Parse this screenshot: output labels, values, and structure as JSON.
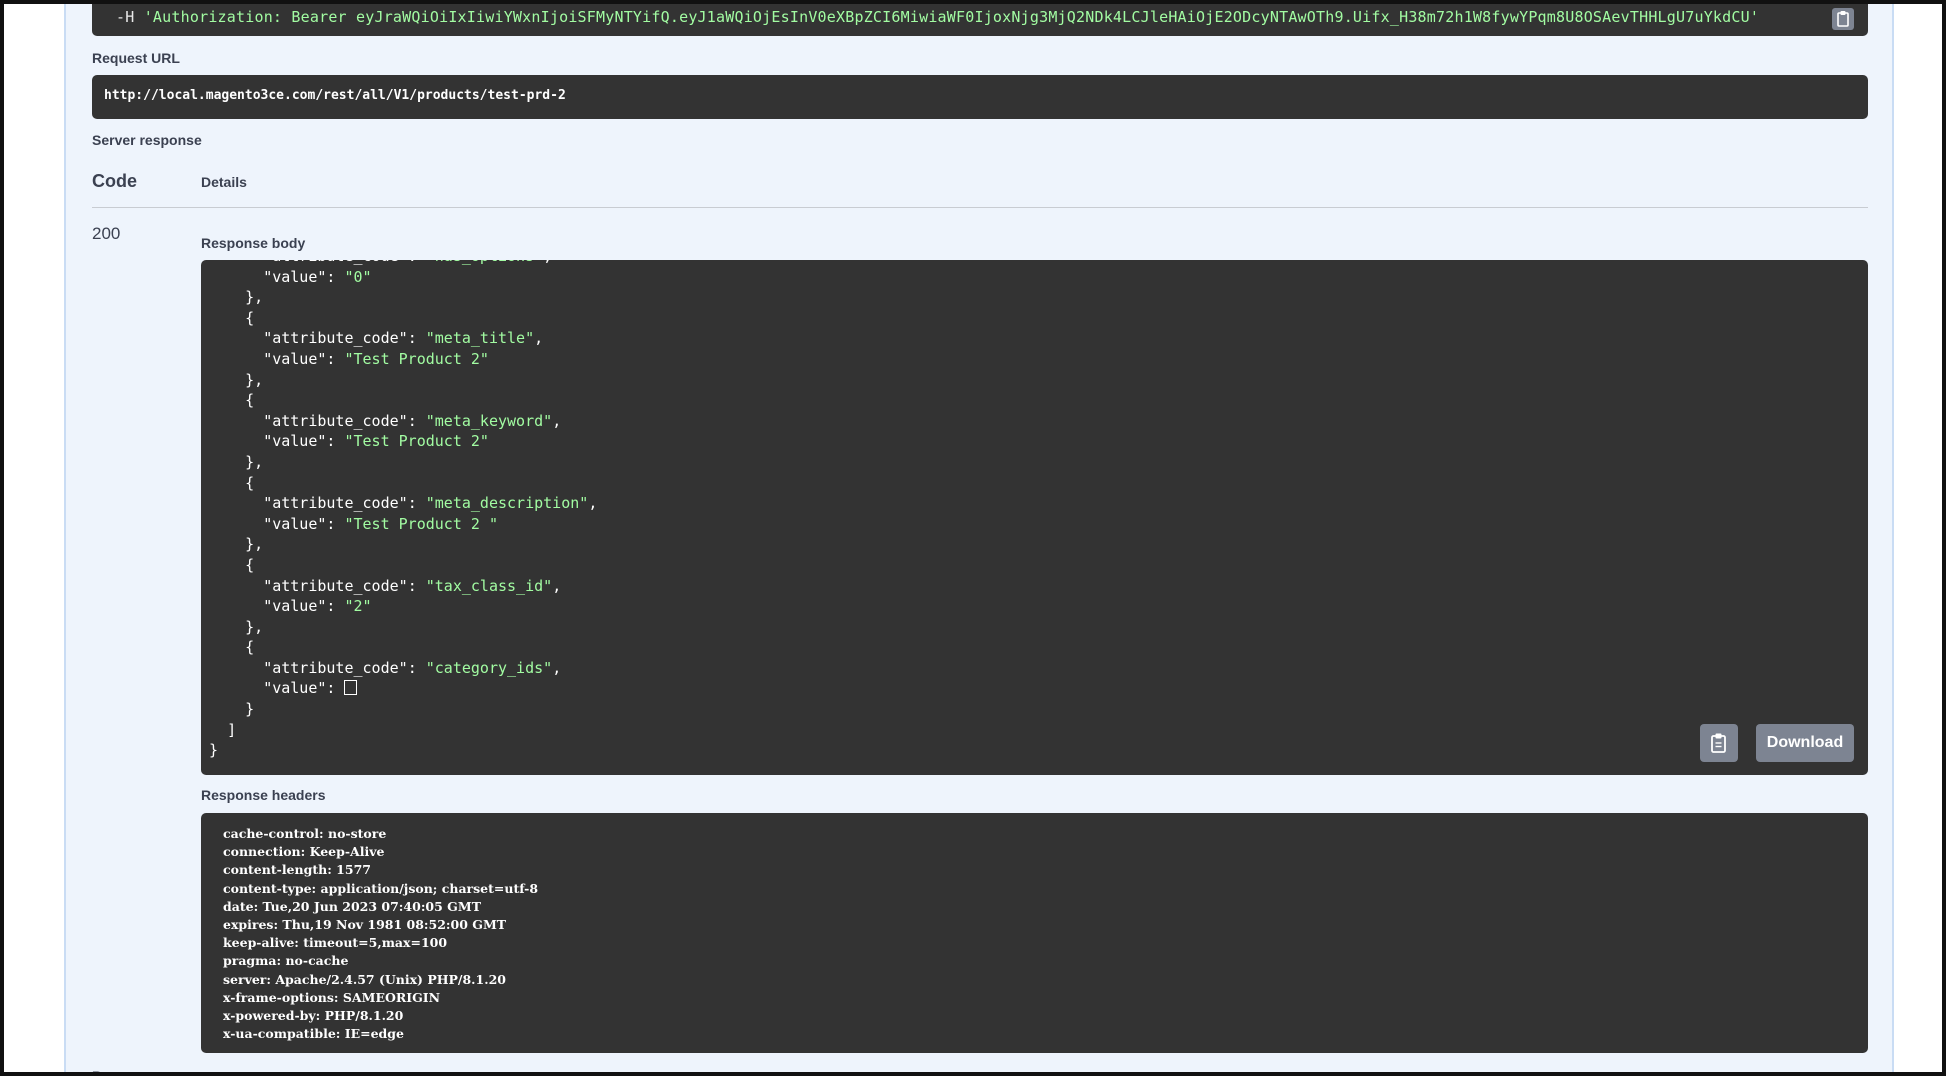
{
  "curl": {
    "prefix": "-H ",
    "header_string": "'Authorization: Bearer eyJraWQiOiIxIiwiYWxnIjoiSFMyNTYifQ.eyJ1aWQiOjEsInV0eXBpZCI6MiwiaWF0IjoxNjg3MjQ2NDk4LCJleHAiOjE2ODcyNTAwOTh9.Uifx_H38m72h1W8fywYPqm8U8OSAevTHHLgU7uYkdCU'"
  },
  "request_url": {
    "label": "Request URL",
    "value": "http://local.magento3ce.com/rest/all/V1/products/test-prd-2"
  },
  "server_response": {
    "label": "Server response",
    "code_header": "Code",
    "details_header": "Details",
    "status_code": "200",
    "response_body_label": "Response body",
    "response_body_lines": [
      {
        "indent": "      ",
        "key": "\"attribute_code\"",
        "value": "\"has_options\"",
        "trail": ","
      },
      {
        "indent": "      ",
        "key": "\"value\"",
        "value": "\"0\"",
        "trail": ""
      },
      {
        "indent": "    ",
        "text": "},"
      },
      {
        "indent": "    ",
        "text": "{"
      },
      {
        "indent": "      ",
        "key": "\"attribute_code\"",
        "value": "\"meta_title\"",
        "trail": ","
      },
      {
        "indent": "      ",
        "key": "\"value\"",
        "value": "\"Test Product 2\"",
        "trail": ""
      },
      {
        "indent": "    ",
        "text": "},"
      },
      {
        "indent": "    ",
        "text": "{"
      },
      {
        "indent": "      ",
        "key": "\"attribute_code\"",
        "value": "\"meta_keyword\"",
        "trail": ","
      },
      {
        "indent": "      ",
        "key": "\"value\"",
        "value": "\"Test Product 2\"",
        "trail": ""
      },
      {
        "indent": "    ",
        "text": "},"
      },
      {
        "indent": "    ",
        "text": "{"
      },
      {
        "indent": "      ",
        "key": "\"attribute_code\"",
        "value": "\"meta_description\"",
        "trail": ","
      },
      {
        "indent": "      ",
        "key": "\"value\"",
        "value": "\"Test Product 2 \"",
        "trail": ""
      },
      {
        "indent": "    ",
        "text": "},"
      },
      {
        "indent": "    ",
        "text": "{"
      },
      {
        "indent": "      ",
        "key": "\"attribute_code\"",
        "value": "\"tax_class_id\"",
        "trail": ","
      },
      {
        "indent": "      ",
        "key": "\"value\"",
        "value": "\"2\"",
        "trail": ""
      },
      {
        "indent": "    ",
        "text": "},"
      },
      {
        "indent": "    ",
        "text": "{"
      },
      {
        "indent": "      ",
        "key": "\"attribute_code\"",
        "value": "\"category_ids\"",
        "trail": ","
      },
      {
        "indent": "      ",
        "key": "\"value\"",
        "empty_array": true
      },
      {
        "indent": "    ",
        "text": "}"
      },
      {
        "indent": "  ",
        "text": "]"
      },
      {
        "indent": "",
        "text": "}"
      }
    ],
    "download_label": "Download",
    "response_headers_label": "Response headers",
    "response_headers": [
      "cache-control: no-store",
      "connection: Keep-Alive",
      "content-length: 1577",
      "content-type: application/json; charset=utf-8",
      "date: Tue,20 Jun 2023 07:40:05 GMT",
      "expires: Thu,19 Nov 1981 08:52:00 GMT",
      "keep-alive: timeout=5,max=100",
      "pragma: no-cache",
      "server: Apache/2.4.57 (Unix) PHP/8.1.20",
      "x-frame-options: SAMEORIGIN",
      "x-powered-by: PHP/8.1.20",
      "x-ua-compatible: IE=edge"
    ]
  },
  "next_section_label": "Responses",
  "icons": {
    "copy": "clipboard-copy-icon"
  },
  "colors": {
    "panel_bg": "#eef4fc",
    "code_bg": "#333333",
    "string_green": "#a2fca2",
    "button_gray": "#7d8492",
    "label_text": "#3b4151"
  }
}
